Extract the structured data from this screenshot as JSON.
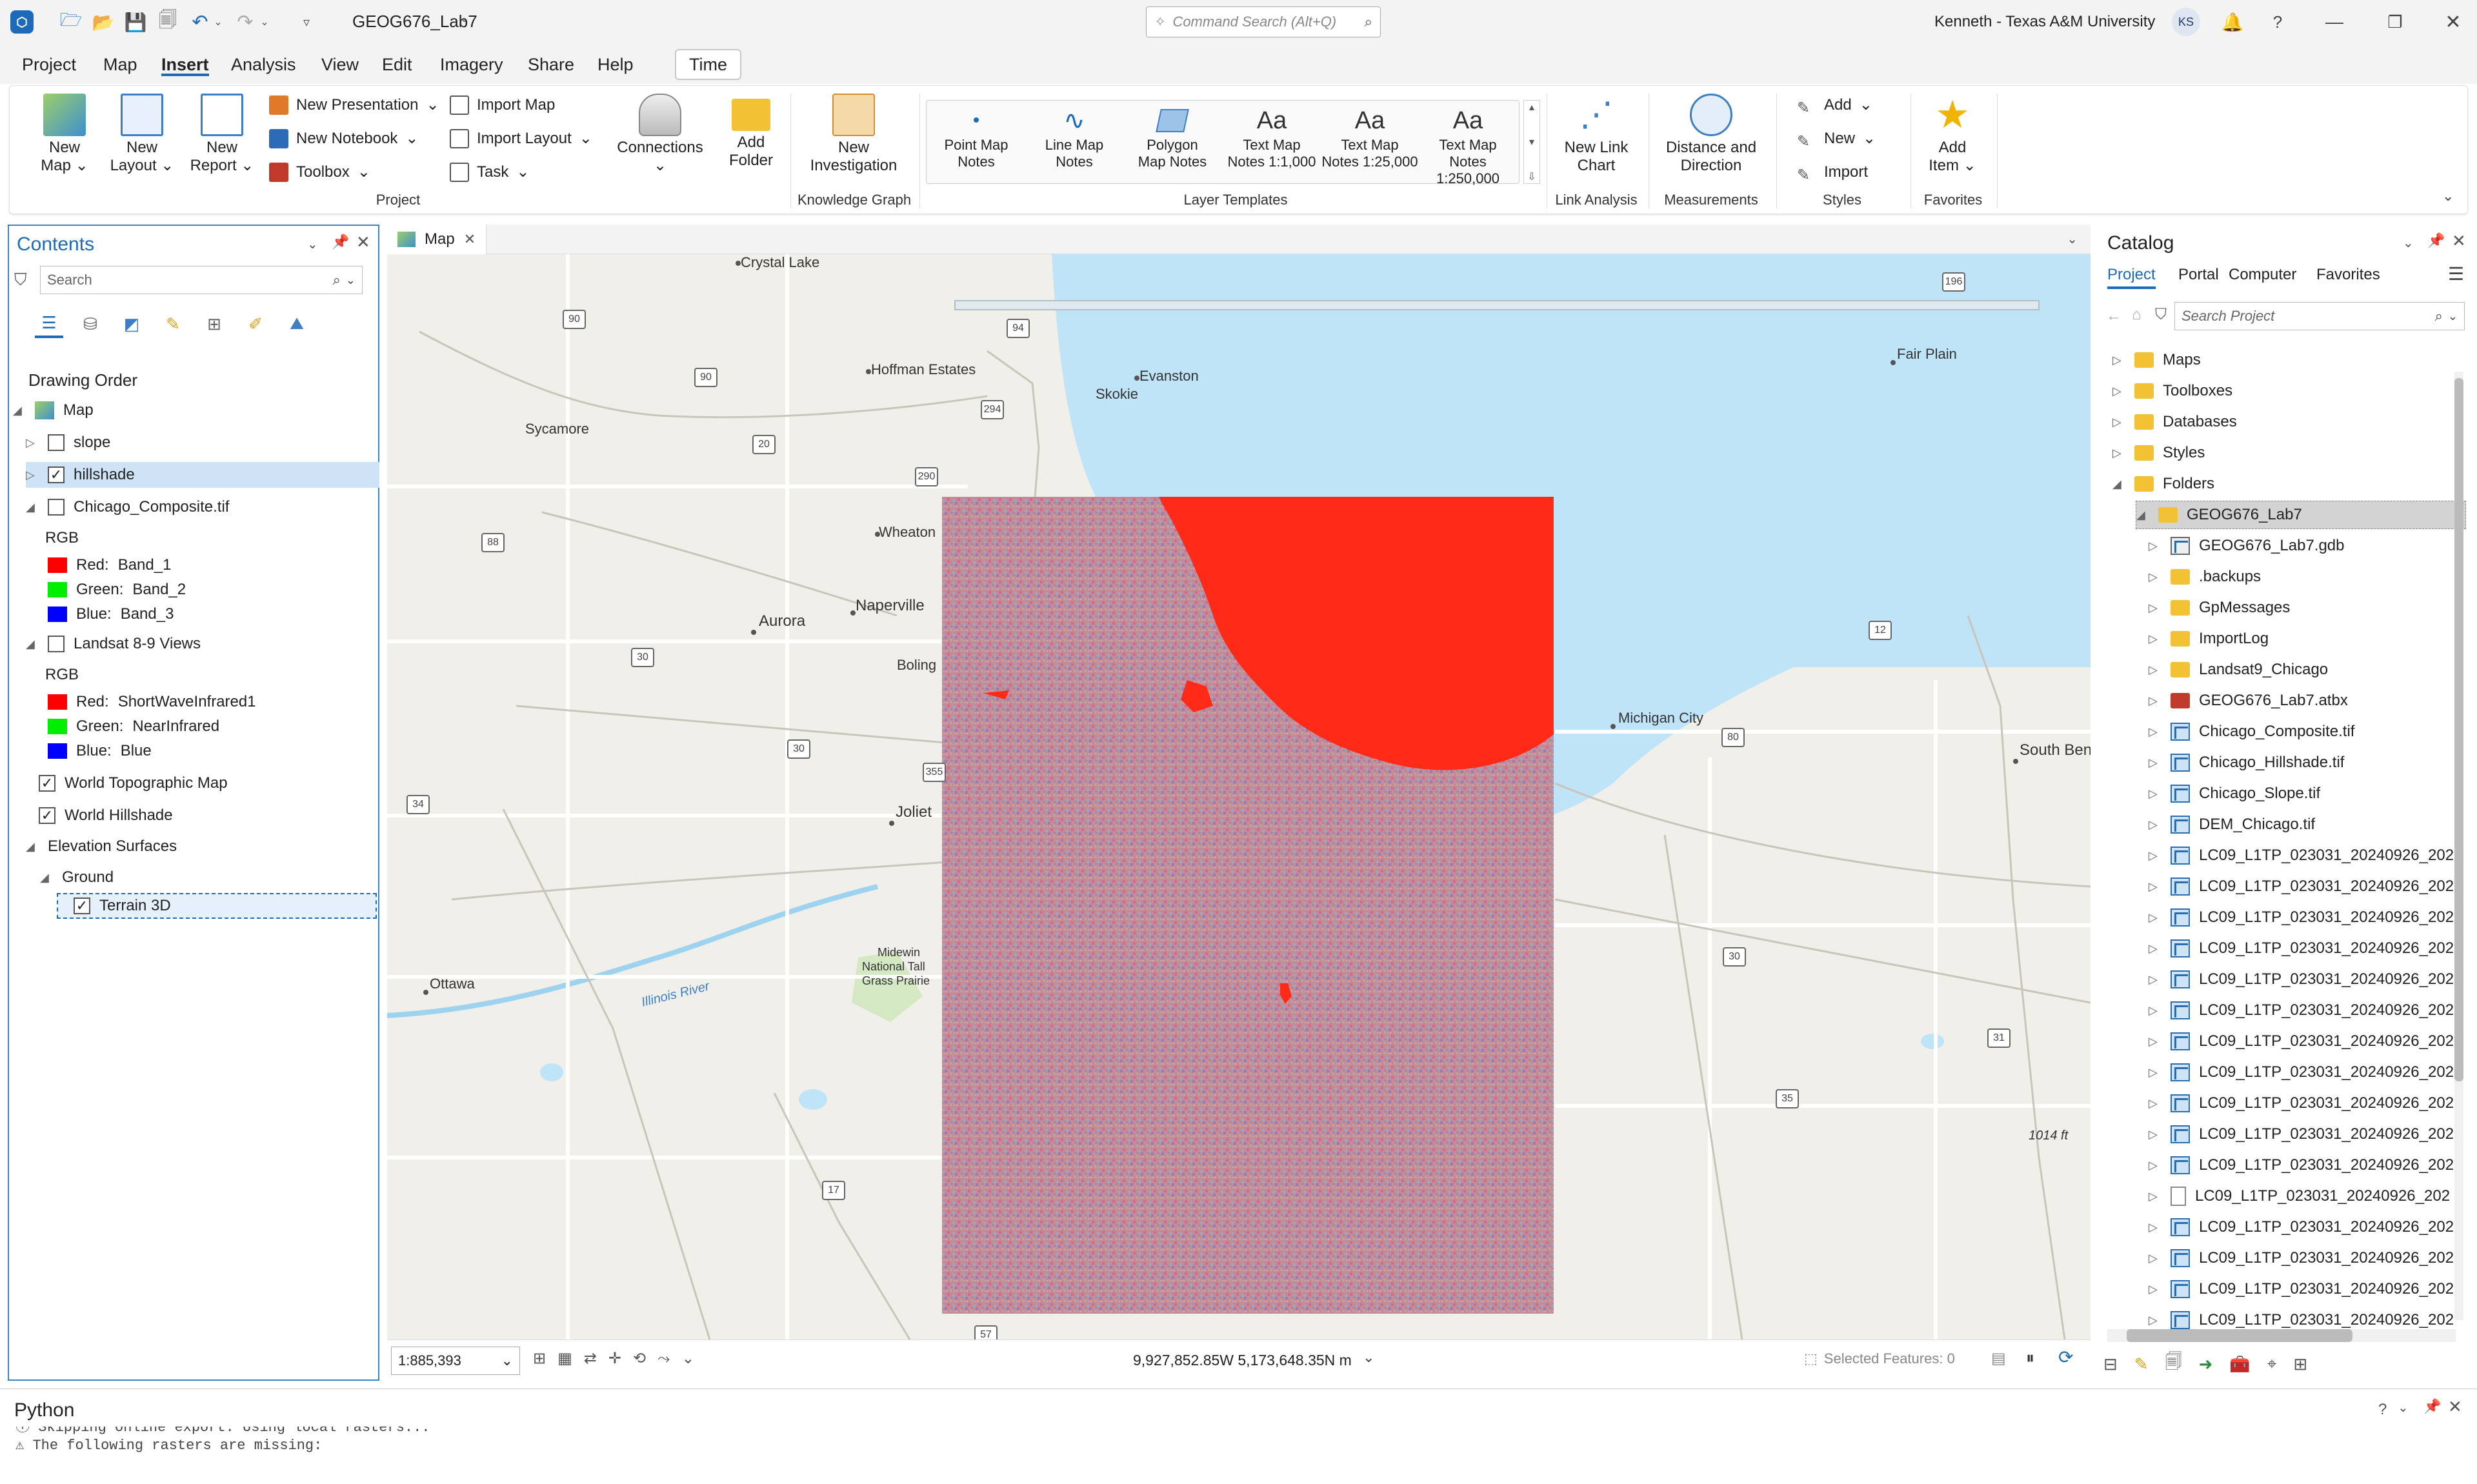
{
  "titlebar": {
    "project_name": "GEOG676_Lab7",
    "command_search_placeholder": "Command Search (Alt+Q)",
    "user": "Kenneth - Texas A&M University",
    "avatar_initials": "KS",
    "help": "?"
  },
  "menu": [
    "Project",
    "Map",
    "Insert",
    "Analysis",
    "View",
    "Edit",
    "Imagery",
    "Share",
    "Help",
    "Time"
  ],
  "menu_active": "Insert",
  "ribbon": {
    "project": {
      "new_map": [
        "New",
        "Map"
      ],
      "new_layout": [
        "New",
        "Layout"
      ],
      "new_report": [
        "New",
        "Report"
      ],
      "new_presentation": "New Presentation",
      "new_notebook": "New Notebook",
      "toolbox": "Toolbox",
      "import_map": "Import Map",
      "import_layout": "Import Layout",
      "task": "Task",
      "connections": "Connections",
      "add_folder": [
        "Add",
        "Folder"
      ],
      "label": "Project"
    },
    "knowledge_graph": {
      "new_investigation": [
        "New",
        "Investigation"
      ],
      "label": "Knowledge Graph"
    },
    "layer_templates": {
      "items": [
        [
          "Point Map",
          "Notes"
        ],
        [
          "Line Map",
          "Notes"
        ],
        [
          "Polygon",
          "Map Notes"
        ],
        [
          "Text Map",
          "Notes 1:1,000"
        ],
        [
          "Text Map",
          "Notes 1:25,000"
        ],
        [
          "Text Map Notes",
          "1:250,000"
        ]
      ],
      "label": "Layer Templates"
    },
    "link_analysis": {
      "new_link_chart": [
        "New Link",
        "Chart"
      ],
      "label": "Link Analysis"
    },
    "measurements": {
      "distance_direction": [
        "Distance and",
        "Direction"
      ],
      "label": "Measurements"
    },
    "styles": {
      "add": "Add",
      "new": "New",
      "import": "Import",
      "label": "Styles"
    },
    "favorites": {
      "add_item": [
        "Add",
        "Item"
      ],
      "label": "Favorites"
    }
  },
  "contents": {
    "title": "Contents",
    "search_placeholder": "Search",
    "drawing_order": "Drawing Order",
    "map": "Map",
    "layers": {
      "slope": "slope",
      "hillshade": "hillshade",
      "composite": "Chicago_Composite.tif",
      "rgb": "RGB",
      "composite_bands": [
        {
          "label": "Red:",
          "band": "Band_1",
          "color": "#ff0000"
        },
        {
          "label": "Green:",
          "band": "Band_2",
          "color": "#00ee00"
        },
        {
          "label": "Blue:",
          "band": "Band_3",
          "color": "#0000ff"
        }
      ],
      "landsat": "Landsat 8-9 Views",
      "landsat_bands": [
        {
          "label": "Red:",
          "band": "ShortWaveInfrared1",
          "color": "#ff0000"
        },
        {
          "label": "Green:",
          "band": "NearInfrared",
          "color": "#00ee00"
        },
        {
          "label": "Blue:",
          "band": "Blue",
          "color": "#0000ff"
        }
      ],
      "topo": "World Topographic Map",
      "world_hillshade": "World Hillshade",
      "elevation": "Elevation Surfaces",
      "ground": "Ground",
      "terrain": "Terrain 3D"
    }
  },
  "map": {
    "tab": "Map",
    "scale": "1:885,393",
    "coords": "9,927,852.85W 5,173,648.35N m",
    "selected_features": "Selected Features: 0",
    "places": {
      "crystal_lake": "Crystal Lake",
      "hoffman": "Hoffman Estates",
      "evanston": "Evanston",
      "skokie": "Skokie",
      "sycamore": "Sycamore",
      "wheaton": "Wheaton",
      "aurora": "Aurora",
      "naperville": "Naperville",
      "bolingbrook": "Boling",
      "joliet": "Joliet",
      "ottawa": "Ottawa",
      "illinois_river": "Illinois River",
      "midewin": [
        "Midewin",
        "National Tall",
        "Grass Prairie"
      ],
      "michigan_city": "Michigan City",
      "south_bend": "South Ben",
      "fair_plain": "Fair Plain",
      "elev": "1014 ft"
    },
    "shields": [
      "90",
      "94",
      "90",
      "294",
      "20",
      "290",
      "88",
      "30",
      "30",
      "355",
      "34",
      "17",
      "57",
      "196",
      "12",
      "80",
      "30",
      "31",
      "35"
    ],
    "hazard_color": "#ff2a17",
    "water_color": "#bfe4f7"
  },
  "catalog": {
    "title": "Catalog",
    "tabs": [
      "Project",
      "Portal",
      "Computer",
      "Favorites"
    ],
    "search_placeholder": "Search Project",
    "top_items": [
      "Maps",
      "Toolboxes",
      "Databases",
      "Styles",
      "Folders"
    ],
    "folder": "GEOG676_Lab7",
    "items": [
      {
        "name": "GEOG676_Lab7.gdb",
        "icon": "gdb"
      },
      {
        "name": ".backups",
        "icon": "folder"
      },
      {
        "name": "GpMessages",
        "icon": "folder"
      },
      {
        "name": "ImportLog",
        "icon": "folder"
      },
      {
        "name": "Landsat9_Chicago",
        "icon": "folder"
      },
      {
        "name": "GEOG676_Lab7.atbx",
        "icon": "toolbox"
      },
      {
        "name": "Chicago_Composite.tif",
        "icon": "raster"
      },
      {
        "name": "Chicago_Hillshade.tif",
        "icon": "raster"
      },
      {
        "name": "Chicago_Slope.tif",
        "icon": "raster"
      },
      {
        "name": "DEM_Chicago.tif",
        "icon": "raster"
      },
      {
        "name": "LC09_L1TP_023031_20240926_202",
        "icon": "raster"
      },
      {
        "name": "LC09_L1TP_023031_20240926_202",
        "icon": "raster"
      },
      {
        "name": "LC09_L1TP_023031_20240926_202",
        "icon": "raster"
      },
      {
        "name": "LC09_L1TP_023031_20240926_202",
        "icon": "raster"
      },
      {
        "name": "LC09_L1TP_023031_20240926_202",
        "icon": "raster"
      },
      {
        "name": "LC09_L1TP_023031_20240926_202",
        "icon": "raster"
      },
      {
        "name": "LC09_L1TP_023031_20240926_202",
        "icon": "raster"
      },
      {
        "name": "LC09_L1TP_023031_20240926_202",
        "icon": "raster"
      },
      {
        "name": "LC09_L1TP_023031_20240926_202",
        "icon": "raster"
      },
      {
        "name": "LC09_L1TP_023031_20240926_202",
        "icon": "raster"
      },
      {
        "name": "LC09_L1TP_023031_20240926_202",
        "icon": "raster"
      },
      {
        "name": "LC09_L1TP_023031_20240926_202",
        "icon": "file"
      },
      {
        "name": "LC09_L1TP_023031_20240926_202",
        "icon": "raster-x"
      },
      {
        "name": "LC09_L1TP_023031_20240926_202",
        "icon": "raster"
      },
      {
        "name": "LC09_L1TP_023031_20240926_202",
        "icon": "raster"
      },
      {
        "name": "LC09_L1TP_023031_20240926_202",
        "icon": "raster"
      }
    ]
  },
  "python": {
    "title": "Python",
    "line1": "Skipping online export. Using local rasters...",
    "line2": "The following rasters are missing:"
  }
}
